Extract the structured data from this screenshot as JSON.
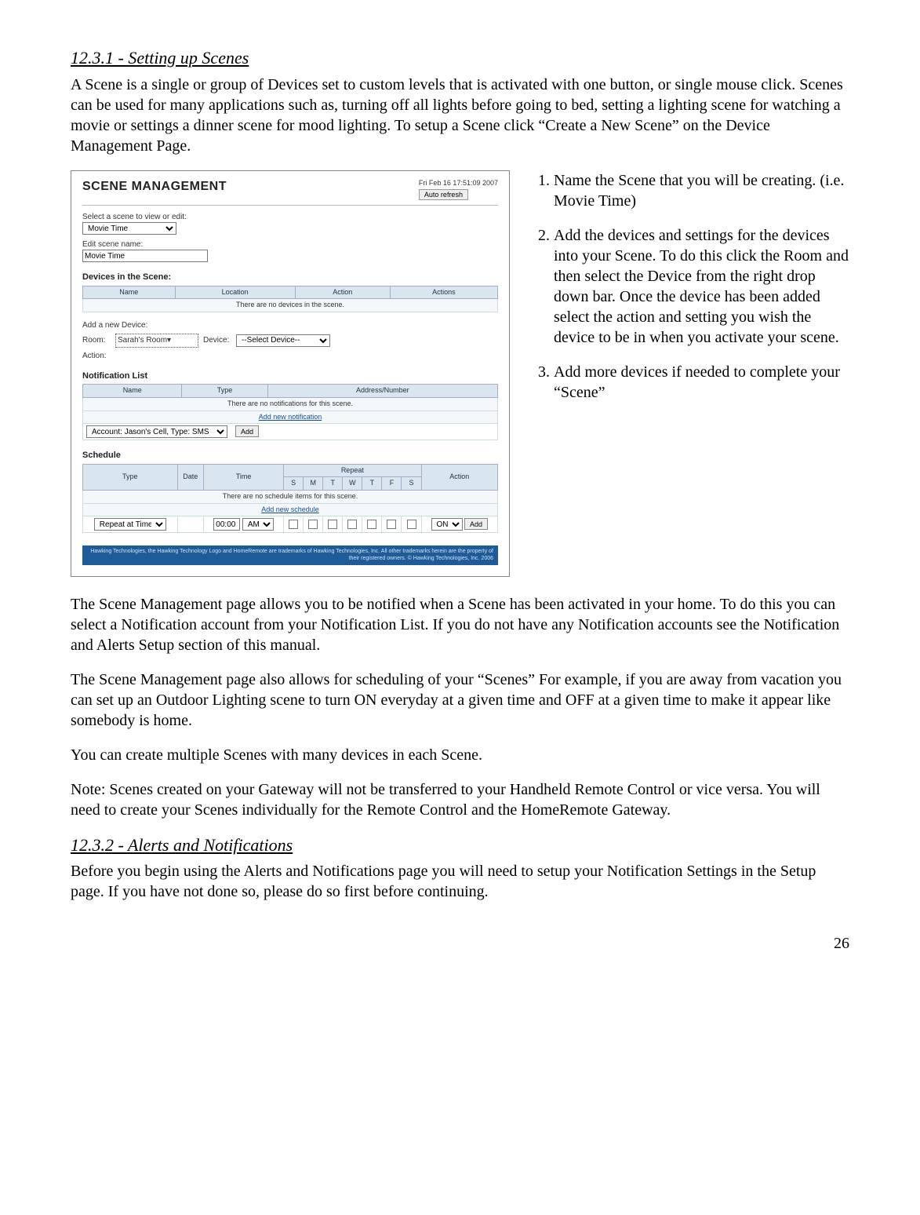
{
  "sections": {
    "s1_heading": "12.3.1 - Setting up Scenes",
    "s1_para": "A Scene is a single or group of Devices set to custom levels that is activated with one button, or single mouse click.   Scenes can be used for many applications such as, turning off all lights before going to bed, setting a lighting scene for watching a movie or settings a dinner scene for mood lighting.  To setup a Scene click “Create a New Scene” on the Device Management Page.",
    "s2_heading": "12.3.2 - Alerts and Notifications",
    "s2_para": "Before you begin using the Alerts and Notifications page you will need to setup your Notification Settings in the Setup page.  If you have not done so, please do so first before continuing."
  },
  "steps": {
    "i1": "Name the Scene that you will be creating.  (i.e. Movie Time)",
    "i2": "Add the devices and settings for the devices into your Scene.  To do this click the Room and then select the Device from the right drop down bar.  Once the device has been added select the action and setting you wish the device to be in when you activate your scene.",
    "i3": "Add more devices if needed to complete your “Scene”"
  },
  "paras": {
    "p1": "The Scene Management page allows you to be notified when a Scene has been activated in your home.  To do this you can select a Notification account from your Notification List.  If you do not have any Notification accounts see the Notification and Alerts Setup section of this manual.",
    "p2": "The Scene Management page also allows for scheduling of your “Scenes” For example, if you are away from vacation you can set up an Outdoor Lighting scene to turn ON everyday at a given time and OFF at a given time to make it appear like somebody is home.",
    "p3": "You can create multiple Scenes with many devices in each Scene.",
    "p4": "Note: Scenes created on your Gateway will not be transferred to your Handheld Remote Control or vice versa.  You will need to create your Scenes individually for the Remote Control and the HomeRemote Gateway."
  },
  "screenshot": {
    "panel_title": "SCENE MANAGEMENT",
    "timestamp": "Fri Feb 16 17:51:09 2007",
    "auto_refresh": "Auto refresh",
    "select_label": "Select a scene to view or edit:",
    "scene_select_value": "Movie Time",
    "edit_name_label": "Edit scene name:",
    "edit_name_value": "Movie Time",
    "devices_heading": "Devices in the Scene:",
    "dev_cols": {
      "name": "Name",
      "location": "Location",
      "action": "Action",
      "actions": "Actions"
    },
    "dev_empty": "There are no devices in the scene.",
    "add_device_heading": "Add a new Device:",
    "room_label": "Room:",
    "room_value": "Sarah's Room",
    "device_label": "Device:",
    "device_value": "--Select Device--",
    "action_label": "Action:",
    "notif_heading": "Notification List",
    "notif_cols": {
      "name": "Name",
      "type": "Type",
      "addr": "Address/Number"
    },
    "notif_empty": "There are no notifications for this scene.",
    "add_notif_link": "Add new notification",
    "account_select": "Account: Jason's Cell, Type: SMS",
    "add_btn": "Add",
    "sched_heading": "Schedule",
    "sched_cols": {
      "type": "Type",
      "date": "Date",
      "time": "Time",
      "repeat": "Repeat",
      "action": "Action"
    },
    "days": {
      "s1": "S",
      "m": "M",
      "t1": "T",
      "w": "W",
      "t2": "T",
      "f": "F",
      "s2": "S"
    },
    "sched_empty": "There are no schedule items for this scene.",
    "add_sched_link": "Add new schedule",
    "repeat_value": "Repeat at Time",
    "time_value": "00:00",
    "ampm_value": "AM",
    "onoff_value": "ON",
    "footer": "Hawking Technologies, the Hawking Technology Logo and HomeRemote are trademarks of Hawking Technologies, Inc. All other trademarks herein are the property of their registered owners. © Hawking Technologies, Inc. 2006"
  },
  "page_number": "26"
}
